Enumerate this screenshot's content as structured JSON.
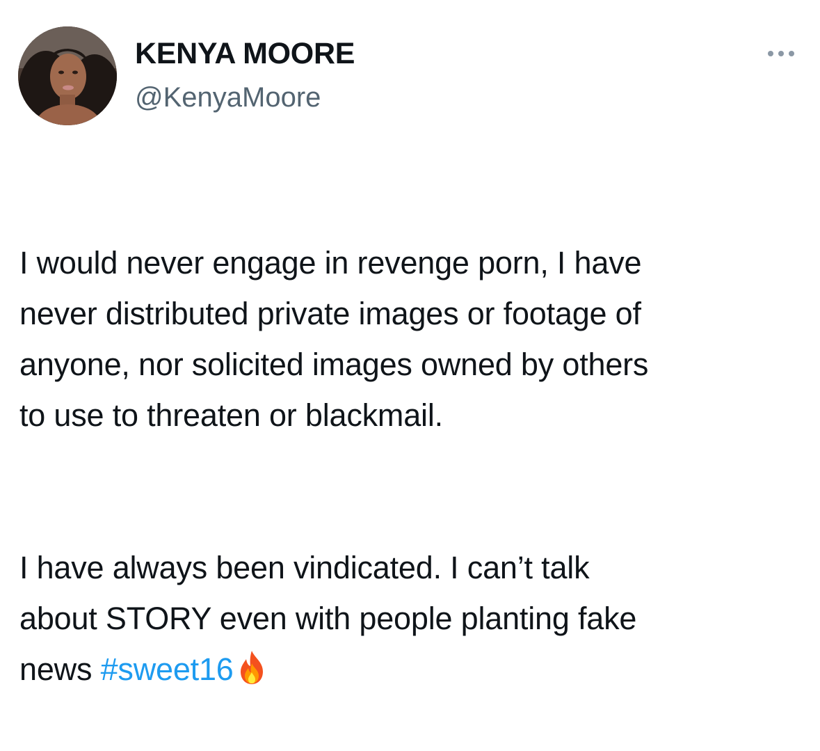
{
  "tweet": {
    "author": {
      "display_name": "KENYA MOORE",
      "handle": "@KenyaMoore",
      "avatar_icon": "profile-photo"
    },
    "more_icon": "ellipsis-icon",
    "paragraph_1": "I would never engage in revenge porn, I have\nnever distributed private images or footage of\nanyone, nor solicited images owned by others\nto use to threaten or blackmail.",
    "paragraph_2_lead": "I have always been vindicated. I can’t talk\nabout STORY even with people planting fake\nnews ",
    "hashtag": "#sweet16",
    "emoji_icon": "fire-icon"
  },
  "colors": {
    "text": "#0f1419",
    "secondary_text": "#536471",
    "link": "#1d9bf0"
  }
}
